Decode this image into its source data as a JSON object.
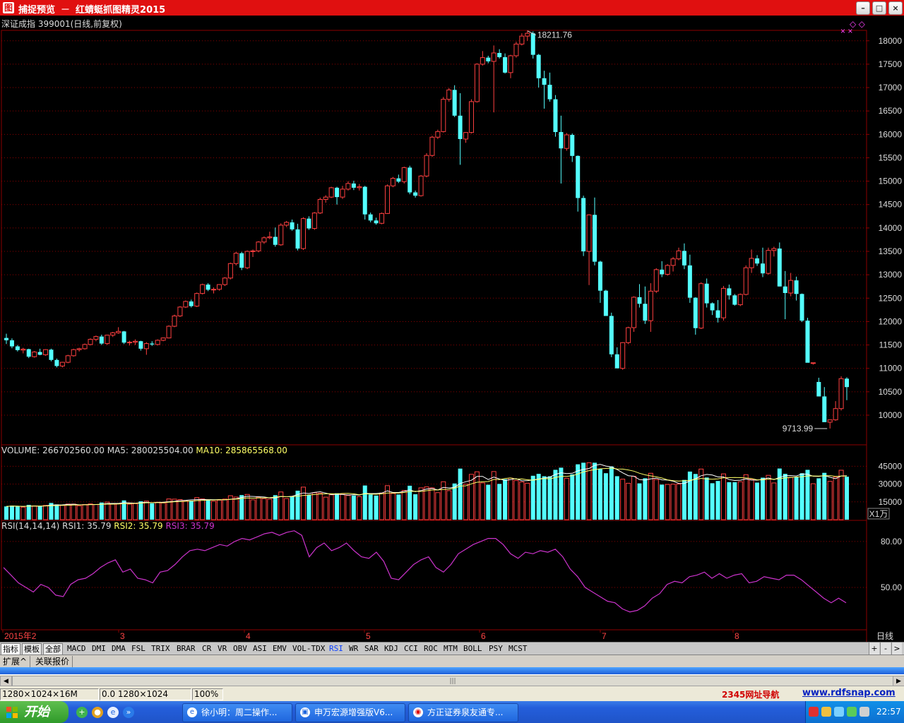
{
  "window": {
    "app_title": "捕捉预览",
    "separator": "－",
    "subtitle": "红蜻蜓抓图精灵2015"
  },
  "instrument": {
    "label": "深证成指 399001(日线,前复权)"
  },
  "price_chart": {
    "high_label": "18211.76",
    "low_label": "9713.99",
    "y_ticks": [
      "18000",
      "17500",
      "17000",
      "16500",
      "16000",
      "15500",
      "15000",
      "14500",
      "14000",
      "13500",
      "13000",
      "12500",
      "12000",
      "11500",
      "11000",
      "10500",
      "10000"
    ],
    "ohlc": [
      [
        11650,
        11740,
        11520,
        11600
      ],
      [
        11600,
        11640,
        11430,
        11470
      ],
      [
        11470,
        11500,
        11360,
        11390
      ],
      [
        11390,
        11440,
        11320,
        11410
      ],
      [
        11410,
        11420,
        11220,
        11250
      ],
      [
        11250,
        11370,
        11230,
        11350
      ],
      [
        11350,
        11420,
        11280,
        11290
      ],
      [
        11290,
        11410,
        11270,
        11400
      ],
      [
        11400,
        11420,
        11150,
        11180
      ],
      [
        11180,
        11210,
        11020,
        11050
      ],
      [
        11050,
        11140,
        11020,
        11130
      ],
      [
        11130,
        11290,
        11110,
        11270
      ],
      [
        11270,
        11420,
        11250,
        11400
      ],
      [
        11400,
        11440,
        11360,
        11420
      ],
      [
        11420,
        11530,
        11400,
        11510
      ],
      [
        11510,
        11640,
        11490,
        11620
      ],
      [
        11620,
        11700,
        11580,
        11680
      ],
      [
        11680,
        11720,
        11500,
        11530
      ],
      [
        11530,
        11720,
        11500,
        11710
      ],
      [
        11710,
        11780,
        11670,
        11760
      ],
      [
        11760,
        11880,
        11740,
        11790
      ],
      [
        11790,
        11800,
        11520,
        11550
      ],
      [
        11550,
        11590,
        11490,
        11560
      ],
      [
        11560,
        11620,
        11500,
        11580
      ],
      [
        11580,
        11590,
        11380,
        11420
      ],
      [
        11420,
        11560,
        11290,
        11530
      ],
      [
        11530,
        11580,
        11480,
        11510
      ],
      [
        11510,
        11620,
        11490,
        11600
      ],
      [
        11600,
        11660,
        11580,
        11650
      ],
      [
        11650,
        11920,
        11640,
        11900
      ],
      [
        11900,
        12150,
        11880,
        12120
      ],
      [
        12120,
        12330,
        12100,
        12310
      ],
      [
        12310,
        12450,
        12290,
        12430
      ],
      [
        12430,
        12470,
        12300,
        12330
      ],
      [
        12330,
        12620,
        12310,
        12600
      ],
      [
        12600,
        12810,
        12580,
        12790
      ],
      [
        12790,
        12820,
        12650,
        12680
      ],
      [
        12680,
        12730,
        12600,
        12690
      ],
      [
        12690,
        12800,
        12660,
        12790
      ],
      [
        12790,
        12950,
        12760,
        12930
      ],
      [
        12930,
        13260,
        12900,
        13240
      ],
      [
        13240,
        13490,
        13200,
        13460
      ],
      [
        13460,
        13490,
        13100,
        13150
      ],
      [
        13150,
        13520,
        13120,
        13500
      ],
      [
        13500,
        13540,
        13380,
        13510
      ],
      [
        13510,
        13720,
        13480,
        13700
      ],
      [
        13700,
        13820,
        13660,
        13790
      ],
      [
        13790,
        13920,
        13760,
        13810
      ],
      [
        13810,
        14010,
        13600,
        13640
      ],
      [
        13640,
        14100,
        13620,
        14060
      ],
      [
        14060,
        14150,
        14020,
        14120
      ],
      [
        14120,
        14180,
        13940,
        13970
      ],
      [
        13970,
        14090,
        13520,
        13560
      ],
      [
        13560,
        14230,
        13530,
        14200
      ],
      [
        14200,
        14250,
        13960,
        13990
      ],
      [
        13990,
        14340,
        13960,
        14320
      ],
      [
        14320,
        14650,
        14300,
        14610
      ],
      [
        14610,
        14700,
        14540,
        14660
      ],
      [
        14660,
        14880,
        14640,
        14860
      ],
      [
        14860,
        14880,
        14500,
        14660
      ],
      [
        14660,
        14900,
        14620,
        14830
      ],
      [
        14830,
        15000,
        14800,
        14950
      ],
      [
        14950,
        15010,
        14810,
        14860
      ],
      [
        14860,
        14940,
        14800,
        14880
      ],
      [
        14880,
        14900,
        14180,
        14290
      ],
      [
        14290,
        14330,
        14120,
        14160
      ],
      [
        14160,
        14220,
        14070,
        14100
      ],
      [
        14100,
        14330,
        14080,
        14310
      ],
      [
        14310,
        14930,
        14300,
        14900
      ],
      [
        14900,
        15090,
        14870,
        15060
      ],
      [
        15060,
        15140,
        14960,
        14990
      ],
      [
        14990,
        15310,
        14950,
        15290
      ],
      [
        15290,
        15330,
        14720,
        14760
      ],
      [
        14760,
        14800,
        14650,
        14690
      ],
      [
        14690,
        15130,
        14670,
        15110
      ],
      [
        15110,
        15600,
        15080,
        15550
      ],
      [
        15550,
        15970,
        15520,
        15940
      ],
      [
        15940,
        16100,
        15900,
        16060
      ],
      [
        16060,
        16800,
        16040,
        16750
      ],
      [
        16750,
        16990,
        16700,
        16950
      ],
      [
        16950,
        17050,
        16370,
        16400
      ],
      [
        16400,
        16880,
        15350,
        15900
      ],
      [
        15900,
        16050,
        15820,
        16040
      ],
      [
        16040,
        16750,
        16020,
        16700
      ],
      [
        16700,
        17520,
        16680,
        17500
      ],
      [
        17500,
        17780,
        17470,
        17640
      ],
      [
        17640,
        17680,
        17520,
        17560
      ],
      [
        17560,
        17900,
        16470,
        17740
      ],
      [
        17740,
        17820,
        17620,
        17650
      ],
      [
        17650,
        17730,
        17300,
        17320
      ],
      [
        17320,
        17700,
        17200,
        17680
      ],
      [
        17680,
        17980,
        17640,
        17930
      ],
      [
        17930,
        18160,
        17900,
        18100
      ],
      [
        18100,
        18211.76,
        18000,
        18160
      ],
      [
        18160,
        18200,
        17620,
        17700
      ],
      [
        17700,
        17720,
        17000,
        17200
      ],
      [
        17200,
        17360,
        16550,
        17060
      ],
      [
        17060,
        17320,
        16700,
        16750
      ],
      [
        16750,
        16840,
        15950,
        16050
      ],
      [
        16050,
        16400,
        14950,
        15700
      ],
      [
        15700,
        16030,
        15650,
        15990
      ],
      [
        15990,
        16020,
        15410,
        15540
      ],
      [
        15540,
        15550,
        14350,
        14640
      ],
      [
        14640,
        14690,
        13400,
        13500
      ],
      [
        13500,
        14290,
        12780,
        14280
      ],
      [
        14280,
        14650,
        13200,
        13280
      ],
      [
        13280,
        13300,
        12400,
        12660
      ],
      [
        12660,
        12680,
        12150,
        12120
      ],
      [
        12120,
        12190,
        11240,
        11300
      ],
      [
        11300,
        11450,
        11030,
        11000
      ],
      [
        11000,
        11560,
        10970,
        11550
      ],
      [
        11550,
        11890,
        11520,
        11870
      ],
      [
        11870,
        12540,
        11780,
        12520
      ],
      [
        12520,
        12800,
        12300,
        12380
      ],
      [
        12380,
        12750,
        11950,
        12020
      ],
      [
        12020,
        12820,
        11780,
        12650
      ],
      [
        12650,
        13140,
        12610,
        13110
      ],
      [
        13110,
        13290,
        12950,
        13010
      ],
      [
        13010,
        13230,
        12980,
        13200
      ],
      [
        13200,
        13380,
        13070,
        13340
      ],
      [
        13340,
        13580,
        13310,
        13510
      ],
      [
        13510,
        13670,
        13120,
        13200
      ],
      [
        13200,
        13430,
        12400,
        12510
      ],
      [
        12510,
        12520,
        11720,
        11860
      ],
      [
        11860,
        12840,
        11840,
        12810
      ],
      [
        12810,
        12920,
        12300,
        12390
      ],
      [
        12390,
        12410,
        12140,
        12240
      ],
      [
        12240,
        12460,
        11980,
        12080
      ],
      [
        12080,
        12760,
        12020,
        12710
      ],
      [
        12710,
        12790,
        12470,
        12560
      ],
      [
        12560,
        12590,
        12340,
        12360
      ],
      [
        12360,
        12600,
        12330,
        12580
      ],
      [
        12580,
        13200,
        12560,
        13150
      ],
      [
        13150,
        13540,
        13040,
        13350
      ],
      [
        13350,
        13420,
        13190,
        13240
      ],
      [
        13240,
        13580,
        12950,
        13030
      ],
      [
        13030,
        13580,
        13000,
        13520
      ],
      [
        13520,
        13600,
        13390,
        13560
      ],
      [
        13560,
        13690,
        12750,
        12750
      ],
      [
        12750,
        13080,
        12050,
        12610
      ],
      [
        12610,
        13040,
        12540,
        12880
      ],
      [
        12880,
        12960,
        12450,
        12590
      ],
      [
        12590,
        12600,
        11990,
        12020
      ],
      [
        12020,
        12080,
        11460,
        11120
      ],
      [
        11120,
        11120,
        11080,
        11120
      ],
      [
        10710,
        10800,
        10520,
        10400
      ],
      [
        10400,
        10600,
        10000,
        9850
      ],
      [
        9850,
        9900,
        9713.99,
        9900
      ],
      [
        9900,
        10300,
        9880,
        10140
      ],
      [
        10140,
        10830,
        10100,
        10780
      ],
      [
        10780,
        10810,
        10320,
        10600
      ]
    ]
  },
  "volume_panel": {
    "label": "VOLUME: 266702560.00",
    "ma5_label": "MA5: 280025504.00",
    "ma10_label": "MA10: 285865568.00",
    "y_ticks": [
      "45000",
      "30000",
      "15000"
    ],
    "unit_button": "X1万"
  },
  "rsi_panel": {
    "label": "RSI(14,14,14)",
    "rsi1_label": "RSI1: 35.79",
    "rsi2_label": "RSI2: 35.79",
    "rsi3_label": "RSI3: 35.79",
    "y_ticks": [
      "80.00",
      "50.00"
    ],
    "series": [
      63,
      58,
      53,
      50,
      47,
      52,
      50,
      45,
      44,
      52,
      55,
      56,
      59,
      63,
      66,
      68,
      60,
      62,
      56,
      55,
      53,
      60,
      61,
      65,
      70,
      74,
      75,
      74,
      76,
      78,
      77,
      80,
      82,
      81,
      83,
      85,
      86,
      84,
      86,
      87,
      84,
      70,
      76,
      79,
      74,
      76,
      79,
      74,
      70,
      69,
      73,
      67,
      56,
      55,
      60,
      65,
      68,
      70,
      63,
      60,
      65,
      72,
      75,
      78,
      80,
      82,
      82,
      78,
      72,
      69,
      73,
      72,
      74,
      73,
      75,
      70,
      62,
      57,
      50,
      47,
      44,
      41,
      40,
      36,
      34,
      35,
      38,
      43,
      46,
      52,
      54,
      53,
      57,
      58,
      60,
      56,
      59,
      56,
      58,
      59,
      53,
      54,
      57,
      56,
      55,
      58,
      58,
      55,
      51,
      47,
      43,
      40,
      43,
      40
    ]
  },
  "date_axis": {
    "labels": [
      "2015年2",
      "3",
      "4",
      "5",
      "6",
      "7",
      "8"
    ],
    "period_button": "日线"
  },
  "tabs": {
    "main": [
      "指标",
      "模板",
      "全部"
    ],
    "metrics": [
      "MACD",
      "DMI",
      "DMA",
      "FSL",
      "TRIX",
      "BRAR",
      "CR",
      "VR",
      "OBV",
      "ASI",
      "EMV",
      "VOL-TDX",
      "RSI",
      "WR",
      "SAR",
      "KDJ",
      "CCI",
      "ROC",
      "MTM",
      "BOLL",
      "PSY",
      "MCST"
    ],
    "active_metric": "RSI",
    "nav": [
      "+",
      "-",
      ">"
    ]
  },
  "ext_bar": {
    "btn1": "扩展^",
    "btn2": "关联报价"
  },
  "status": {
    "field1": "1280×1024×16M",
    "field2": "0.0 1280×1024",
    "field3": "100%",
    "nav_2345": "2345网址导航",
    "rdf_url": "www.rdfsnap.com"
  },
  "taskbar": {
    "start_label": "开始",
    "items": [
      "徐小明：周二操作...",
      "申万宏源增强版V6...",
      "方正证券泉友通专..."
    ],
    "clock": "22:57"
  },
  "colors": {
    "up": "#ff4040",
    "down": "#54ffff",
    "grid": "#8b0000",
    "ma10": "#ffff66",
    "rsi": "#cc33cc"
  }
}
